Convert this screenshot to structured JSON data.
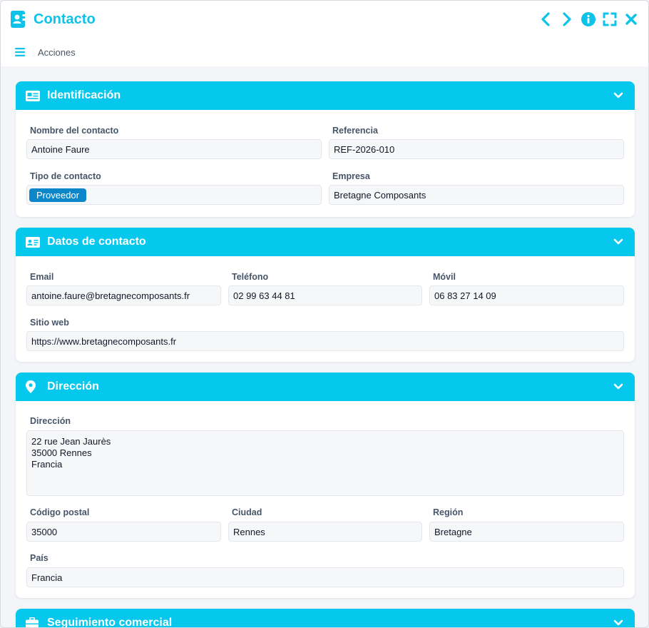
{
  "window": {
    "title": "Contacto"
  },
  "menu": {
    "label": "Acciones"
  },
  "sections": {
    "identificacion": {
      "title": "Identificación",
      "fields": {
        "nombre": {
          "label": "Nombre del contacto",
          "value": "Antoine Faure"
        },
        "referencia": {
          "label": "Referencia",
          "value": "REF-2026-010"
        },
        "tipo": {
          "label": "Tipo de contacto",
          "value": "Proveedor"
        },
        "empresa": {
          "label": "Empresa",
          "value": "Bretagne Composants"
        }
      }
    },
    "datos": {
      "title": "Datos de contacto",
      "fields": {
        "email": {
          "label": "Email",
          "value": "antoine.faure@bretagnecomposants.fr"
        },
        "telefono": {
          "label": "Teléfono",
          "value": "02 99 63 44 81"
        },
        "movil": {
          "label": "Móvil",
          "value": "06 83 27 14 09"
        },
        "web": {
          "label": "Sitio web",
          "value": "https://www.bretagnecomposants.fr"
        }
      }
    },
    "direccion": {
      "title": "Dirección",
      "fields": {
        "direccion": {
          "label": "Dirección",
          "value": "22 rue Jean Jaurès\n35000 Rennes\nFrancia"
        },
        "cp": {
          "label": "Código postal",
          "value": "35000"
        },
        "ciudad": {
          "label": "Ciudad",
          "value": "Rennes"
        },
        "region": {
          "label": "Región",
          "value": "Bretagne"
        },
        "pais": {
          "label": "País",
          "value": "Francia"
        }
      }
    },
    "seguimiento": {
      "title": "Seguimiento comercial"
    }
  },
  "colors": {
    "accent": "#06c8ec",
    "title": "#0fc3e8",
    "tag": "#0b87c9"
  },
  "icons": {
    "title": "address-book-icon",
    "prev": "chevron-left-icon",
    "next": "chevron-right-icon",
    "info": "info-icon",
    "maximize": "expand-icon",
    "close": "close-icon",
    "menu": "hamburger-icon",
    "id_card": "id-card-icon",
    "contact_card": "contact-card-icon",
    "location": "map-pin-icon",
    "briefcase": "briefcase-icon",
    "collapse": "chevron-down-icon"
  }
}
